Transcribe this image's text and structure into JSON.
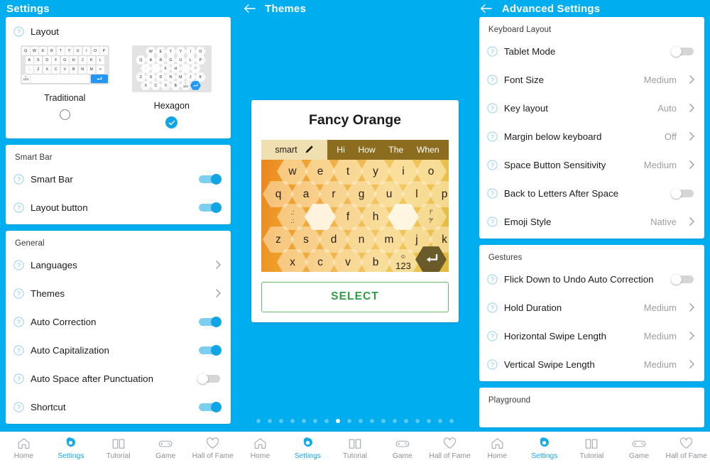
{
  "theme_colors": {
    "brand_blue": "#00AEEF",
    "toggle_on": "#11a6e3",
    "select_green": "#2e9e46",
    "nav_active": "#14a9e8"
  },
  "screens": [
    {
      "id": "settings",
      "header": {
        "title": "Settings",
        "has_back": false
      },
      "layout_card": {
        "title": "Layout",
        "choices": [
          {
            "name": "Traditional",
            "selected": false
          },
          {
            "name": "Hexagon",
            "selected": true
          }
        ],
        "traditional_rows": [
          [
            "Q",
            "W",
            "E",
            "R",
            "T",
            "Y",
            "U",
            "I",
            "O",
            "P"
          ],
          [
            "A",
            "S",
            "D",
            "F",
            "G",
            "H",
            "J",
            "K",
            "L"
          ],
          [
            "Z",
            "X",
            "C",
            "V",
            "B",
            "N",
            "M"
          ]
        ],
        "traditional_bottom": {
          "num_key": "123",
          "enter_key": "enter-icon"
        },
        "hexagon_rows": [
          [
            "W",
            "E",
            "T",
            "Y",
            "I",
            "O"
          ],
          [
            "Q",
            "A",
            "R",
            "G",
            "U",
            "L",
            "P"
          ],
          [
            "F",
            "H"
          ],
          [
            "Z",
            "S",
            "D",
            "N",
            "M",
            "J",
            "K"
          ],
          [
            "X",
            "C",
            "V",
            "B"
          ]
        ],
        "hexagon_bottom": {
          "num_key": "123",
          "enter_key": "enter-icon"
        }
      },
      "cards": [
        {
          "title": "Smart Bar",
          "rows": [
            {
              "label": "Smart Bar",
              "control": "toggle",
              "state": "on"
            },
            {
              "label": "Layout button",
              "control": "toggle",
              "state": "on"
            }
          ]
        },
        {
          "title": "General",
          "rows": [
            {
              "label": "Languages",
              "control": "chevron",
              "value": ""
            },
            {
              "label": "Themes",
              "control": "chevron",
              "value": ""
            },
            {
              "label": "Auto Correction",
              "control": "toggle",
              "state": "on"
            },
            {
              "label": "Auto Capitalization",
              "control": "toggle",
              "state": "on"
            },
            {
              "label": "Auto Space after Punctuation",
              "control": "toggle",
              "state": "off"
            },
            {
              "label": "Shortcut",
              "control": "toggle",
              "state": "on"
            }
          ]
        }
      ]
    },
    {
      "id": "themes",
      "header": {
        "title": "Themes",
        "has_back": true
      },
      "theme": {
        "name": "Fancy Orange",
        "smart_bar": {
          "smart_label": "smart",
          "pencil_icon": "pencil-icon",
          "suggestions": [
            "Hi",
            "How",
            "The",
            "When"
          ]
        },
        "keyboard_rows": [
          [
            "w",
            "e",
            "t",
            "y",
            "i",
            "o"
          ],
          [
            "q",
            "a",
            "r",
            "g",
            "u",
            "l",
            "p"
          ],
          [
            "f",
            "h"
          ],
          [
            "z",
            "s",
            "d",
            "n",
            "m",
            "j",
            "k"
          ],
          [
            "x",
            "c",
            "v",
            "b"
          ]
        ],
        "punct_left": [
          ".:",
          ".:"
        ],
        "punct_right": [
          "!'",
          "?'"
        ],
        "num_key": "123",
        "emoji_icon": "emoji-icon",
        "enter_icon": "enter-icon",
        "select_label": "SELECT"
      },
      "pagination": {
        "total": 18,
        "active_index": 7
      }
    },
    {
      "id": "advanced",
      "header": {
        "title": "Advanced Settings",
        "has_back": true
      },
      "cards": [
        {
          "title": "Keyboard Layout",
          "rows": [
            {
              "label": "Tablet Mode",
              "control": "toggle",
              "state": "off"
            },
            {
              "label": "Font Size",
              "control": "chevron",
              "value": "Medium"
            },
            {
              "label": "Key layout",
              "control": "chevron",
              "value": "Auto"
            },
            {
              "label": "Margin below keyboard",
              "control": "chevron",
              "value": "Off"
            },
            {
              "label": "Space Button Sensitivity",
              "control": "chevron",
              "value": "Medium"
            },
            {
              "label": "Back to Letters After Space",
              "control": "toggle",
              "state": "off"
            },
            {
              "label": "Emoji Style",
              "control": "chevron",
              "value": "Native"
            }
          ]
        },
        {
          "title": "Gestures",
          "rows": [
            {
              "label": "Flick Down to Undo Auto Correction",
              "control": "toggle",
              "state": "off"
            },
            {
              "label": "Hold Duration",
              "control": "chevron",
              "value": "Medium"
            },
            {
              "label": "Horizontal Swipe Length",
              "control": "chevron",
              "value": "Medium"
            },
            {
              "label": "Vertical Swipe Length",
              "control": "chevron",
              "value": "Medium"
            }
          ]
        },
        {
          "title": "Playground",
          "rows": []
        }
      ]
    }
  ],
  "nav": {
    "items": [
      {
        "label": "Home",
        "icon": "home-icon",
        "active": false
      },
      {
        "label": "Settings",
        "icon": "gear-icon",
        "active": true
      },
      {
        "label": "Tutorial",
        "icon": "book-icon",
        "active": false
      },
      {
        "label": "Game",
        "icon": "gamepad-icon",
        "active": false
      },
      {
        "label": "Hall of Fame",
        "icon": "heart-icon",
        "active": false
      }
    ]
  }
}
